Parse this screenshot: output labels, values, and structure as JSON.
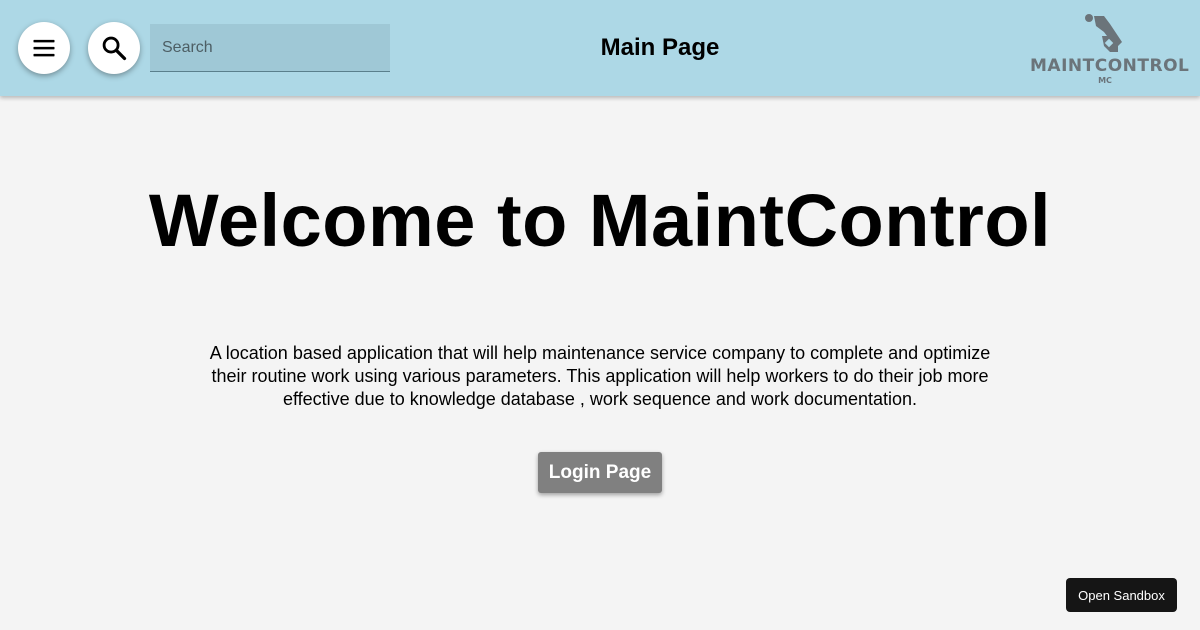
{
  "header": {
    "title": "Main Page",
    "menu_icon": "hamburger-menu-icon",
    "search_icon": "magnifier-search-icon",
    "search": {
      "placeholder": "Search",
      "value": ""
    },
    "logo": {
      "name": "MAINTCONTROL",
      "abbr": "MC",
      "icon": "wrench-tool-icon"
    },
    "colors": {
      "background": "#add8e6",
      "logo": "#6b747a"
    }
  },
  "main": {
    "heading": "Welcome to MaintControl",
    "description": "A location based application that will help maintenance service company to complete and optimize their routine work using various parameters. This application will help workers to do their job more effective due to knowledge database , work sequence and work documentation.",
    "login_button": "Login Page",
    "colors": {
      "background": "#f4f4f4",
      "login_button": "#808080"
    }
  },
  "footer": {
    "sandbox_button": "Open Sandbox"
  }
}
